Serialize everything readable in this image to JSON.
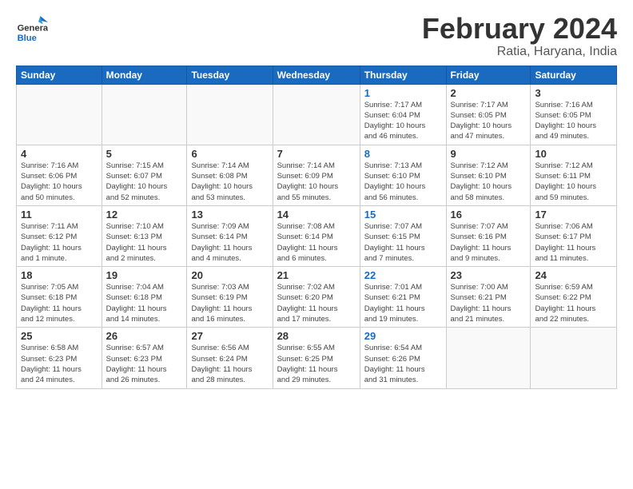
{
  "header": {
    "logo": {
      "general": "General",
      "blue": "Blue"
    },
    "title": "February 2024",
    "location": "Ratia, Haryana, India"
  },
  "weekdays": [
    "Sunday",
    "Monday",
    "Tuesday",
    "Wednesday",
    "Thursday",
    "Friday",
    "Saturday"
  ],
  "weeks": [
    [
      {
        "day": "",
        "info": ""
      },
      {
        "day": "",
        "info": ""
      },
      {
        "day": "",
        "info": ""
      },
      {
        "day": "",
        "info": ""
      },
      {
        "day": "1",
        "isThursday": true,
        "info": "Sunrise: 7:17 AM\nSunset: 6:04 PM\nDaylight: 10 hours\nand 46 minutes."
      },
      {
        "day": "2",
        "info": "Sunrise: 7:17 AM\nSunset: 6:05 PM\nDaylight: 10 hours\nand 47 minutes."
      },
      {
        "day": "3",
        "info": "Sunrise: 7:16 AM\nSunset: 6:05 PM\nDaylight: 10 hours\nand 49 minutes."
      }
    ],
    [
      {
        "day": "4",
        "info": "Sunrise: 7:16 AM\nSunset: 6:06 PM\nDaylight: 10 hours\nand 50 minutes."
      },
      {
        "day": "5",
        "info": "Sunrise: 7:15 AM\nSunset: 6:07 PM\nDaylight: 10 hours\nand 52 minutes."
      },
      {
        "day": "6",
        "info": "Sunrise: 7:14 AM\nSunset: 6:08 PM\nDaylight: 10 hours\nand 53 minutes."
      },
      {
        "day": "7",
        "info": "Sunrise: 7:14 AM\nSunset: 6:09 PM\nDaylight: 10 hours\nand 55 minutes."
      },
      {
        "day": "8",
        "isThursday": true,
        "info": "Sunrise: 7:13 AM\nSunset: 6:10 PM\nDaylight: 10 hours\nand 56 minutes."
      },
      {
        "day": "9",
        "info": "Sunrise: 7:12 AM\nSunset: 6:10 PM\nDaylight: 10 hours\nand 58 minutes."
      },
      {
        "day": "10",
        "info": "Sunrise: 7:12 AM\nSunset: 6:11 PM\nDaylight: 10 hours\nand 59 minutes."
      }
    ],
    [
      {
        "day": "11",
        "info": "Sunrise: 7:11 AM\nSunset: 6:12 PM\nDaylight: 11 hours\nand 1 minute."
      },
      {
        "day": "12",
        "info": "Sunrise: 7:10 AM\nSunset: 6:13 PM\nDaylight: 11 hours\nand 2 minutes."
      },
      {
        "day": "13",
        "info": "Sunrise: 7:09 AM\nSunset: 6:14 PM\nDaylight: 11 hours\nand 4 minutes."
      },
      {
        "day": "14",
        "info": "Sunrise: 7:08 AM\nSunset: 6:14 PM\nDaylight: 11 hours\nand 6 minutes."
      },
      {
        "day": "15",
        "isThursday": true,
        "info": "Sunrise: 7:07 AM\nSunset: 6:15 PM\nDaylight: 11 hours\nand 7 minutes."
      },
      {
        "day": "16",
        "info": "Sunrise: 7:07 AM\nSunset: 6:16 PM\nDaylight: 11 hours\nand 9 minutes."
      },
      {
        "day": "17",
        "info": "Sunrise: 7:06 AM\nSunset: 6:17 PM\nDaylight: 11 hours\nand 11 minutes."
      }
    ],
    [
      {
        "day": "18",
        "info": "Sunrise: 7:05 AM\nSunset: 6:18 PM\nDaylight: 11 hours\nand 12 minutes."
      },
      {
        "day": "19",
        "info": "Sunrise: 7:04 AM\nSunset: 6:18 PM\nDaylight: 11 hours\nand 14 minutes."
      },
      {
        "day": "20",
        "info": "Sunrise: 7:03 AM\nSunset: 6:19 PM\nDaylight: 11 hours\nand 16 minutes."
      },
      {
        "day": "21",
        "info": "Sunrise: 7:02 AM\nSunset: 6:20 PM\nDaylight: 11 hours\nand 17 minutes."
      },
      {
        "day": "22",
        "isThursday": true,
        "info": "Sunrise: 7:01 AM\nSunset: 6:21 PM\nDaylight: 11 hours\nand 19 minutes."
      },
      {
        "day": "23",
        "info": "Sunrise: 7:00 AM\nSunset: 6:21 PM\nDaylight: 11 hours\nand 21 minutes."
      },
      {
        "day": "24",
        "info": "Sunrise: 6:59 AM\nSunset: 6:22 PM\nDaylight: 11 hours\nand 22 minutes."
      }
    ],
    [
      {
        "day": "25",
        "info": "Sunrise: 6:58 AM\nSunset: 6:23 PM\nDaylight: 11 hours\nand 24 minutes."
      },
      {
        "day": "26",
        "info": "Sunrise: 6:57 AM\nSunset: 6:23 PM\nDaylight: 11 hours\nand 26 minutes."
      },
      {
        "day": "27",
        "info": "Sunrise: 6:56 AM\nSunset: 6:24 PM\nDaylight: 11 hours\nand 28 minutes."
      },
      {
        "day": "28",
        "info": "Sunrise: 6:55 AM\nSunset: 6:25 PM\nDaylight: 11 hours\nand 29 minutes."
      },
      {
        "day": "29",
        "isThursday": true,
        "info": "Sunrise: 6:54 AM\nSunset: 6:26 PM\nDaylight: 11 hours\nand 31 minutes."
      },
      {
        "day": "",
        "info": ""
      },
      {
        "day": "",
        "info": ""
      }
    ]
  ]
}
